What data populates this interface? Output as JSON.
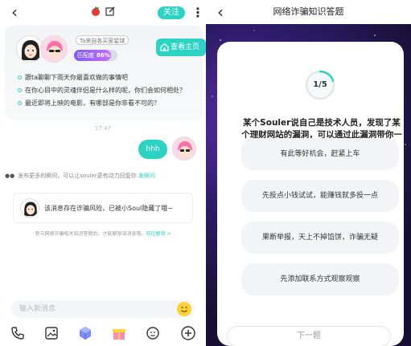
{
  "chat": {
    "header": {
      "back_icon": "back-arrow-icon",
      "follow_label": "关注",
      "more_icon": "more-vertical-icon"
    },
    "profile_card": {
      "from_tag": "Ta来自各买家星球",
      "match_label": "匹配度",
      "match_value": "86%",
      "match_fraction": 0.86,
      "home_label": "查看主页",
      "topics": [
        "跟ta聊聊下雨天你最喜欢做的事情吧",
        "在你心目中的灵魂伴侣是什么样的呢，你们会如何相处？",
        "最近即将上映的电影，有哪部是你非看不可的？"
      ]
    },
    "timestamp": "17:47",
    "message": "hhh",
    "moments_hint": "发布更多的瞬间，可以让souler更有动力回复你",
    "moments_link": "发瞬间",
    "fraud_card_text": "该消息存在诈骗风险，已被小Soul隐藏了哦~",
    "fraud_hint": "参与网络诈骗相关知识答题后，才能解锁该消息哦。",
    "fraud_hint_link": "前往解锁 >",
    "input": {
      "placeholder": "输入新消息"
    },
    "toolbar_icons": [
      "phone-icon",
      "image-icon",
      "cube-icon",
      "gift-icon",
      "voice-avatar-icon",
      "plus-icon"
    ],
    "colors": {
      "accent": "#2cd3c3",
      "match_gradient_start": "#7a5cf0",
      "match_gradient_end": "#c76dff"
    }
  },
  "quiz": {
    "title": "网络诈骗知识答题",
    "progress": "1/5",
    "progress_fraction": 0.2,
    "question": "某个Souler说自己是技术人员，发现了某个理财网站的漏洞，可以通过此漏洞带你一起赚钱，你应该（）",
    "options": [
      "有此等好机会，赶紧上车",
      "先投点小钱试试，能赚钱就多投一点",
      "果断举报，天上不掉馅饼，诈骗无疑",
      "先添加联系方式观察观察"
    ],
    "next_label": "下一题",
    "colors": {
      "background": "#171033",
      "glow": "#5a2ea6"
    }
  }
}
